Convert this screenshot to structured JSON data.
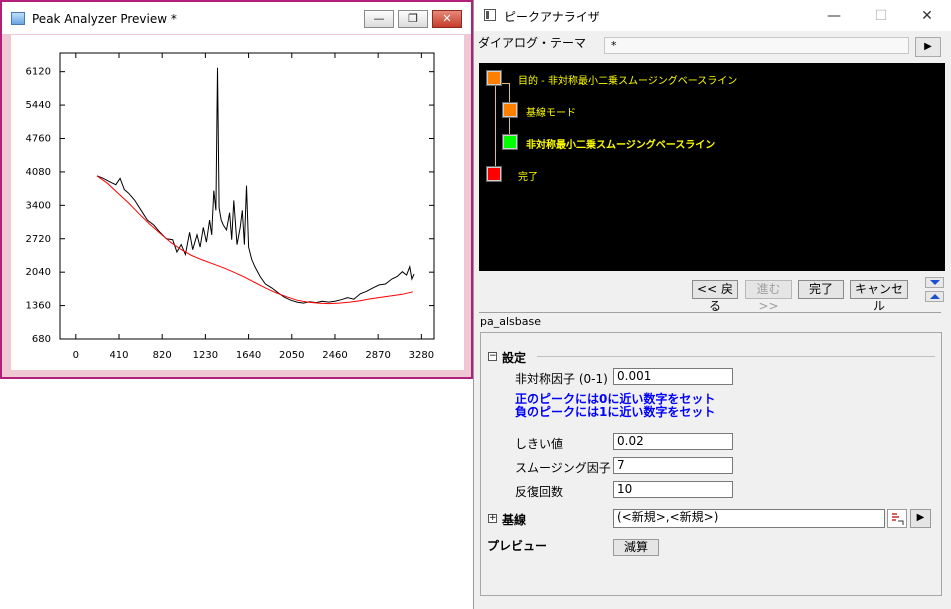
{
  "preview_window": {
    "title": "Peak Analyzer Preview *",
    "minimize_glyph": "—",
    "restore_glyph": "❐",
    "close_glyph": "✕"
  },
  "dialog": {
    "title": "ピークアナライザ",
    "minimize_glyph": "—",
    "maximize_glyph": "☐",
    "close_glyph": "✕",
    "theme_label": "ダイアログ・テーマ",
    "theme_value": "*",
    "theme_arrow": "▶",
    "flow_steps": [
      {
        "label": "目的 - 非対称最小二乗スムージングベースライン",
        "color": "#ff8000",
        "bold": false
      },
      {
        "label": "基線モード",
        "color": "#ff8000",
        "bold": false
      },
      {
        "label": "非対称最小二乗スムージングベースライン",
        "color": "#00ff00",
        "bold": true
      },
      {
        "label": "完了",
        "color": "#ff0000",
        "bold": false
      }
    ],
    "nav": {
      "back": "<< 戻る",
      "next": "進む >>",
      "finish": "完了",
      "cancel": "キャンセル"
    },
    "dialog_name": "pa_alsbase",
    "settings": {
      "label": "設定",
      "expander": "⊟",
      "asymmetric_label": "非対称因子 (0-1)",
      "asymmetric_value": "0.001",
      "hint_line1": "正のピークには0に近い数字をセット",
      "hint_line2": "負のピークには1に近い数字をセット",
      "threshold_label": "しきい値",
      "threshold_value": "0.02",
      "smoothing_label": "スムージング因子",
      "smoothing_value": "7",
      "iterations_label": "反復回数",
      "iterations_value": "10"
    },
    "baseline": {
      "label": "基線",
      "expander": "⊞",
      "value": "(<新規>,<新規>)",
      "arrow": "▶"
    },
    "preview": {
      "label": "プレビュー",
      "button": "減算"
    }
  },
  "chart_data": {
    "type": "line",
    "title": "",
    "xlabel": "",
    "ylabel": "",
    "xlim": [
      -150,
      3400
    ],
    "ylim": [
      680,
      6500
    ],
    "xticks": [
      0,
      410,
      820,
      1230,
      1640,
      2050,
      2460,
      2870,
      3280
    ],
    "yticks": [
      680,
      1360,
      2040,
      2720,
      3400,
      4080,
      4760,
      5440,
      6120
    ],
    "grid": false,
    "legend": "none",
    "series": [
      {
        "color": "#000000",
        "x": [
          200,
          260,
          320,
          380,
          420,
          460,
          500,
          560,
          620,
          680,
          740,
          800,
          860,
          920,
          960,
          1000,
          1040,
          1080,
          1110,
          1150,
          1180,
          1210,
          1240,
          1270,
          1290,
          1310,
          1330,
          1345,
          1360,
          1380,
          1400,
          1430,
          1460,
          1480,
          1500,
          1530,
          1560,
          1580,
          1600,
          1620,
          1640,
          1670,
          1700,
          1750,
          1800,
          1860,
          1920,
          1980,
          2040,
          2100,
          2160,
          2220,
          2280,
          2340,
          2400,
          2460,
          2520,
          2580,
          2640,
          2700,
          2760,
          2820,
          2880,
          2940,
          3000,
          3050,
          3100,
          3140,
          3170,
          3190,
          3210
        ],
        "y": [
          4000,
          3950,
          3880,
          3820,
          3950,
          3720,
          3650,
          3500,
          3300,
          3100,
          3000,
          2850,
          2720,
          2700,
          2450,
          2600,
          2400,
          2850,
          2500,
          2800,
          2550,
          2950,
          2650,
          3100,
          2800,
          3700,
          3300,
          6200,
          3350,
          3100,
          3000,
          2900,
          3250,
          2700,
          3500,
          2600,
          2950,
          3300,
          2600,
          3800,
          2550,
          2300,
          2150,
          1950,
          1800,
          1720,
          1620,
          1530,
          1470,
          1430,
          1410,
          1440,
          1420,
          1450,
          1430,
          1450,
          1480,
          1520,
          1490,
          1600,
          1650,
          1720,
          1780,
          1800,
          1900,
          1950,
          2050,
          1980,
          2150,
          1900,
          2000
        ]
      },
      {
        "color": "#ff0000",
        "x": [
          200,
          300,
          400,
          500,
          600,
          700,
          800,
          900,
          1000,
          1100,
          1200,
          1300,
          1400,
          1500,
          1600,
          1700,
          1800,
          1900,
          2000,
          2100,
          2200,
          2300,
          2400,
          2500,
          2600,
          2700,
          2800,
          2900,
          3000,
          3100,
          3200
        ],
        "y": [
          4000,
          3850,
          3650,
          3450,
          3230,
          3020,
          2830,
          2650,
          2500,
          2380,
          2290,
          2210,
          2130,
          2040,
          1940,
          1830,
          1720,
          1620,
          1540,
          1470,
          1430,
          1410,
          1400,
          1410,
          1430,
          1460,
          1500,
          1530,
          1560,
          1590,
          1640
        ]
      }
    ]
  }
}
